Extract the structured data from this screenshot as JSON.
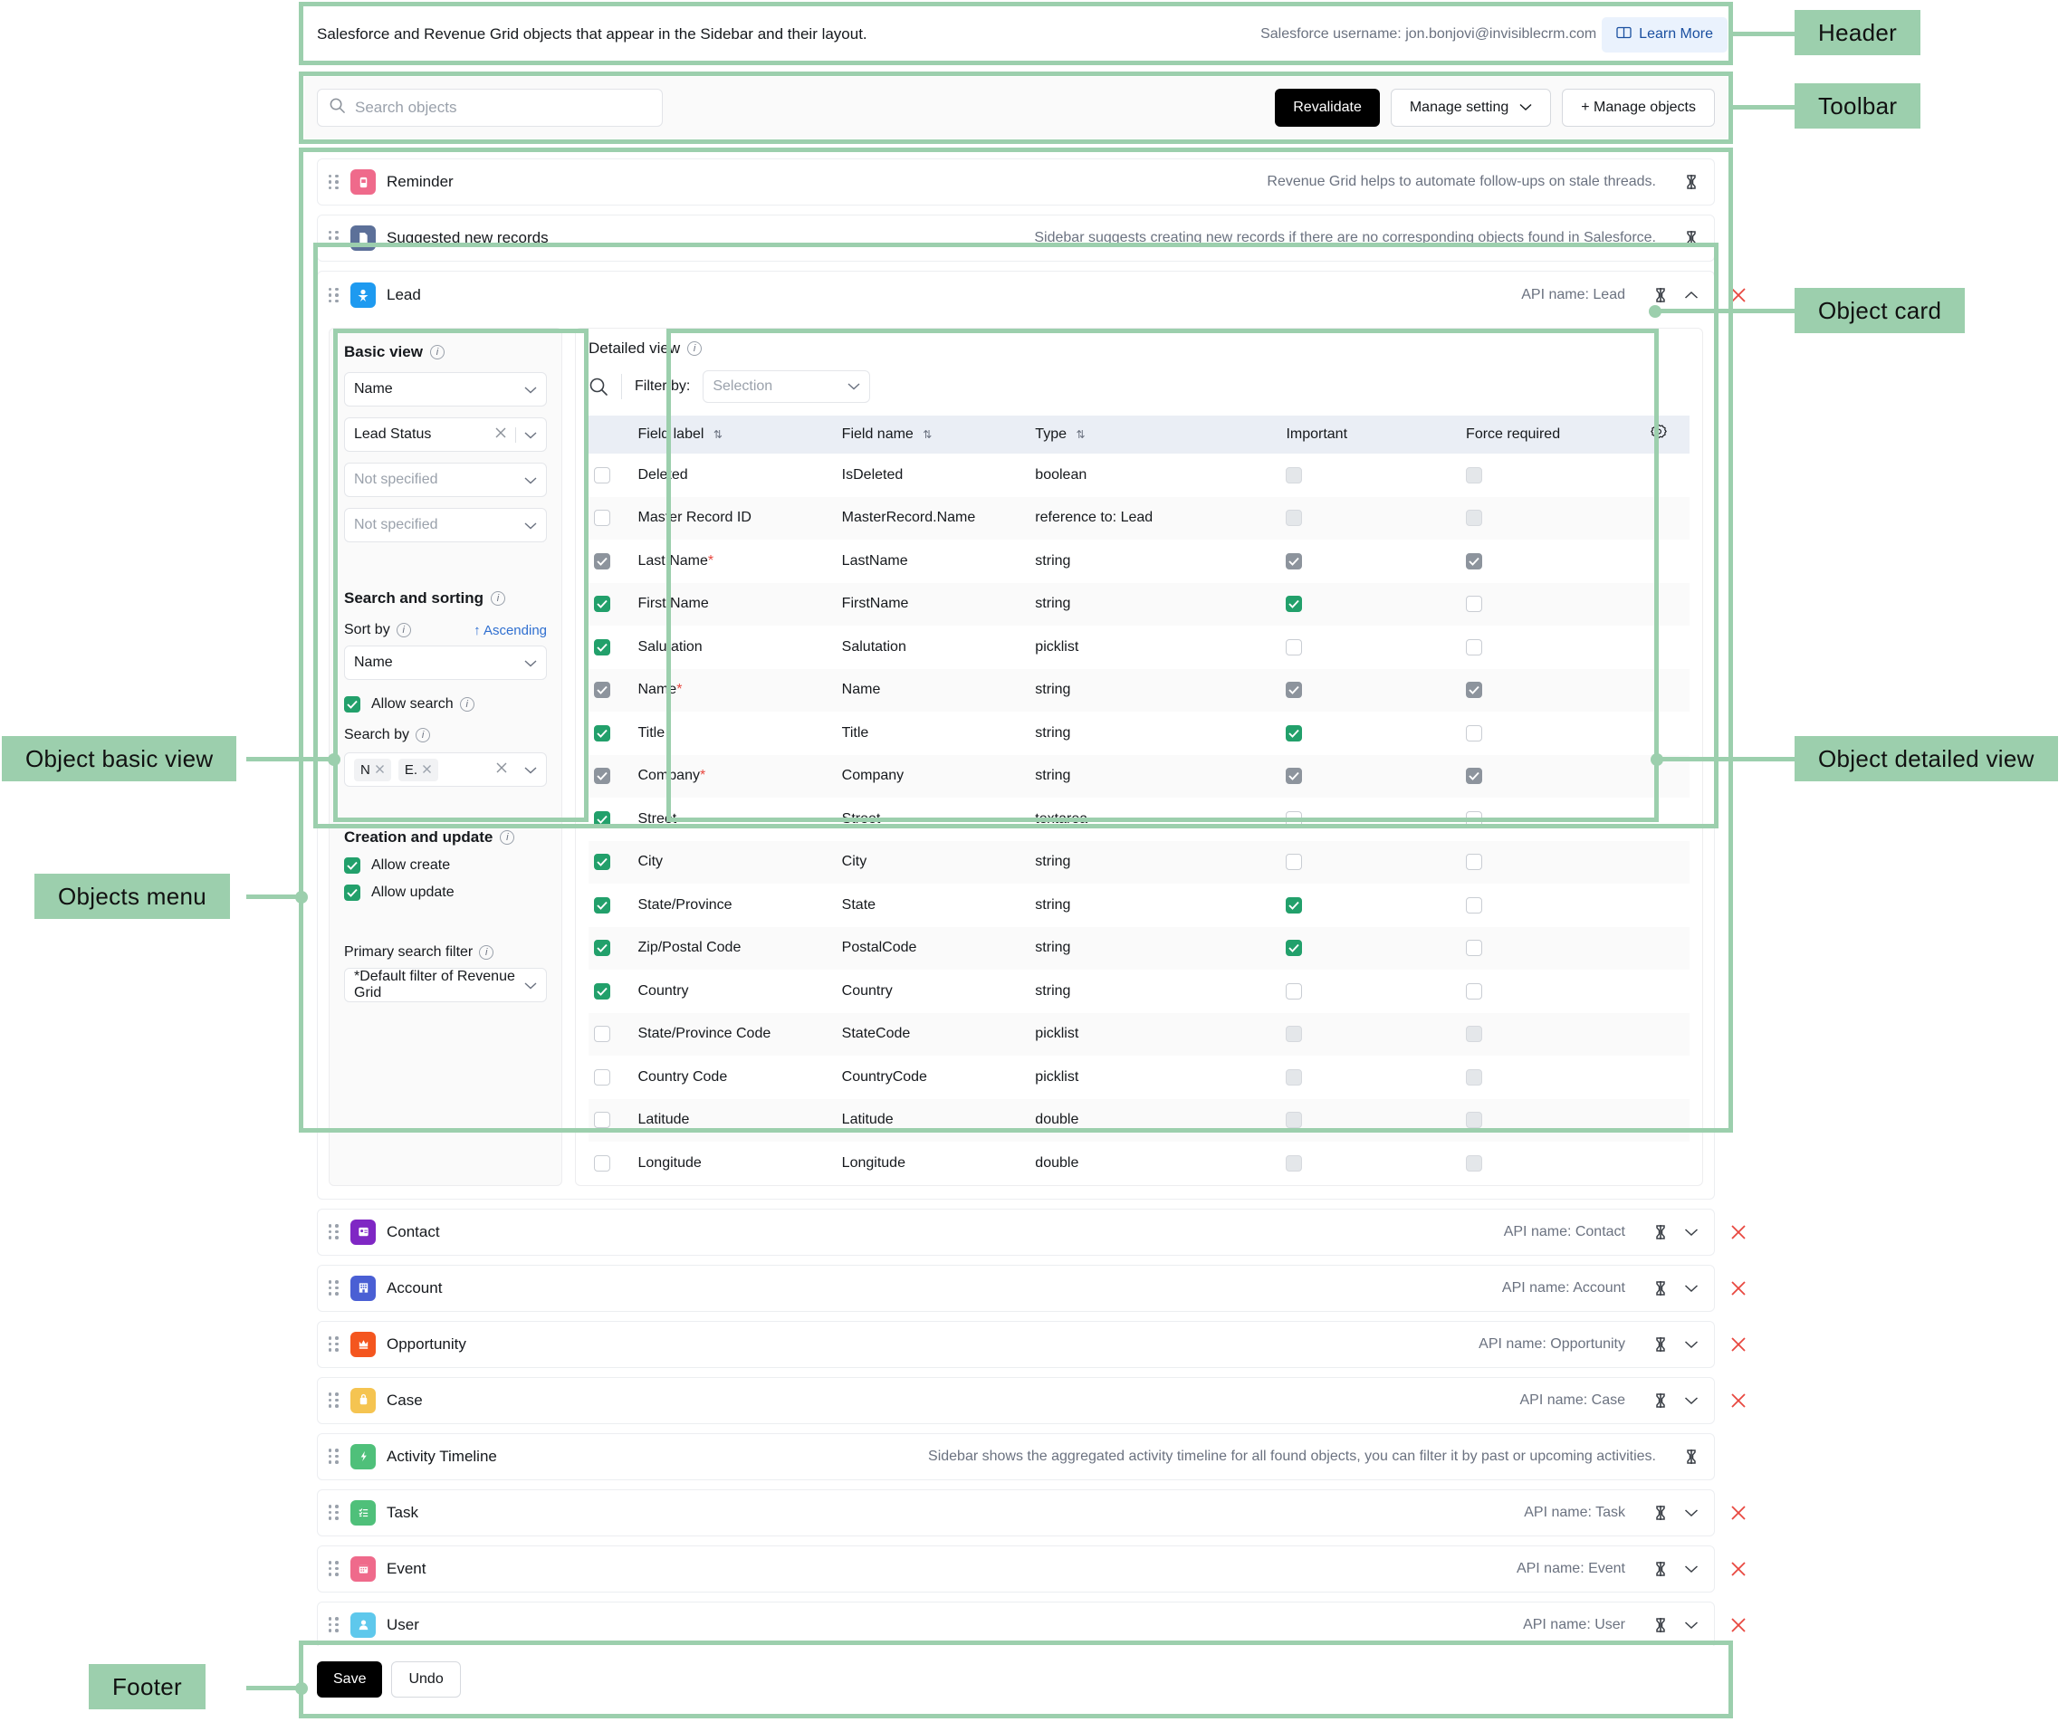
{
  "header": {
    "description": "Salesforce and Revenue Grid objects that appear in the Sidebar and their layout.",
    "username_label": "Salesforce username: jon.bonjovi@invisiblecrm.com",
    "learn_more": "Learn More"
  },
  "toolbar": {
    "search_placeholder": "Search objects",
    "revalidate": "Revalidate",
    "manage_setting": "Manage setting",
    "manage_objects": "+ Manage objects"
  },
  "objects": [
    {
      "name": "Reminder",
      "desc": "Revenue Grid helps to automate follow-ups on stale threads.",
      "color": "#ef6a8b",
      "glyph": "⏰",
      "has_chevron": false,
      "has_close": false
    },
    {
      "name": "Suggested new records",
      "desc": "Sidebar suggests creating new records if there are no corresponding objects found in Salesforce.",
      "color": "#5c7099",
      "glyph": "⬜",
      "has_chevron": false,
      "has_close": false
    }
  ],
  "lead_card": {
    "name": "Lead",
    "api_name": "API name: Lead",
    "color": "#1e9af0",
    "glyph": "★"
  },
  "basic_view": {
    "title": "Basic view",
    "fields": [
      {
        "value": "Name",
        "placeholder": false,
        "clearable": false
      },
      {
        "value": "Lead Status",
        "placeholder": false,
        "clearable": true
      },
      {
        "value": "Not specified",
        "placeholder": true,
        "clearable": false
      },
      {
        "value": "Not specified",
        "placeholder": true,
        "clearable": false
      }
    ],
    "search_sorting_title": "Search and sorting",
    "sort_by_label": "Sort by",
    "sort_direction": "↑ Ascending",
    "sort_by_value": "Name",
    "allow_search_label": "Allow search",
    "allow_search_checked": true,
    "search_by_label": "Search by",
    "search_by_tags": [
      "N",
      "E."
    ],
    "creation_update_title": "Creation and update",
    "allow_create_label": "Allow create",
    "allow_create_checked": true,
    "allow_update_label": "Allow update",
    "allow_update_checked": true,
    "primary_filter_label": "Primary search filter",
    "primary_filter_value": "*Default filter of Revenue Grid"
  },
  "detailed_view": {
    "title": "Detailed view",
    "filter_by_label": "Filter by:",
    "filter_by_value": "Selection",
    "columns": [
      "Field label",
      "Field name",
      "Type",
      "Important",
      "Force required"
    ],
    "rows": [
      {
        "label": "Deleted",
        "required": false,
        "name": "IsDeleted",
        "type": "boolean",
        "sel": false,
        "sel_dis": false,
        "imp": false,
        "imp_dis": true,
        "force": false,
        "force_dis": true
      },
      {
        "label": "Master Record ID",
        "required": false,
        "name": "MasterRecord.Name",
        "type": "reference to: Lead",
        "sel": false,
        "sel_dis": false,
        "imp": false,
        "imp_dis": true,
        "force": false,
        "force_dis": true
      },
      {
        "label": "Last Name",
        "required": true,
        "name": "LastName",
        "type": "string",
        "sel": true,
        "sel_dis": true,
        "imp": true,
        "imp_dis": true,
        "force": true,
        "force_dis": true
      },
      {
        "label": "First Name",
        "required": false,
        "name": "FirstName",
        "type": "string",
        "sel": true,
        "sel_dis": false,
        "imp": true,
        "imp_dis": false,
        "force": false,
        "force_dis": false
      },
      {
        "label": "Salutation",
        "required": false,
        "name": "Salutation",
        "type": "picklist",
        "sel": true,
        "sel_dis": false,
        "imp": false,
        "imp_dis": false,
        "force": false,
        "force_dis": false
      },
      {
        "label": "Name",
        "required": true,
        "name": "Name",
        "type": "string",
        "sel": true,
        "sel_dis": true,
        "imp": true,
        "imp_dis": true,
        "force": true,
        "force_dis": true
      },
      {
        "label": "Title",
        "required": false,
        "name": "Title",
        "type": "string",
        "sel": true,
        "sel_dis": false,
        "imp": true,
        "imp_dis": false,
        "force": false,
        "force_dis": false
      },
      {
        "label": "Company",
        "required": true,
        "name": "Company",
        "type": "string",
        "sel": true,
        "sel_dis": true,
        "imp": true,
        "imp_dis": true,
        "force": true,
        "force_dis": true
      },
      {
        "label": "Street",
        "required": false,
        "name": "Street",
        "type": "textarea",
        "sel": true,
        "sel_dis": false,
        "imp": false,
        "imp_dis": false,
        "force": false,
        "force_dis": false
      },
      {
        "label": "City",
        "required": false,
        "name": "City",
        "type": "string",
        "sel": true,
        "sel_dis": false,
        "imp": false,
        "imp_dis": false,
        "force": false,
        "force_dis": false
      },
      {
        "label": "State/Province",
        "required": false,
        "name": "State",
        "type": "string",
        "sel": true,
        "sel_dis": false,
        "imp": true,
        "imp_dis": false,
        "force": false,
        "force_dis": false
      },
      {
        "label": "Zip/Postal Code",
        "required": false,
        "name": "PostalCode",
        "type": "string",
        "sel": true,
        "sel_dis": false,
        "imp": true,
        "imp_dis": false,
        "force": false,
        "force_dis": false
      },
      {
        "label": "Country",
        "required": false,
        "name": "Country",
        "type": "string",
        "sel": true,
        "sel_dis": false,
        "imp": false,
        "imp_dis": false,
        "force": false,
        "force_dis": false
      },
      {
        "label": "State/Province Code",
        "required": false,
        "name": "StateCode",
        "type": "picklist",
        "sel": false,
        "sel_dis": false,
        "imp": false,
        "imp_dis": true,
        "force": false,
        "force_dis": true
      },
      {
        "label": "Country Code",
        "required": false,
        "name": "CountryCode",
        "type": "picklist",
        "sel": false,
        "sel_dis": false,
        "imp": false,
        "imp_dis": true,
        "force": false,
        "force_dis": true
      },
      {
        "label": "Latitude",
        "required": false,
        "name": "Latitude",
        "type": "double",
        "sel": false,
        "sel_dis": false,
        "imp": false,
        "imp_dis": true,
        "force": false,
        "force_dis": true
      },
      {
        "label": "Longitude",
        "required": false,
        "name": "Longitude",
        "type": "double",
        "sel": false,
        "sel_dis": false,
        "imp": false,
        "imp_dis": true,
        "force": false,
        "force_dis": true
      }
    ]
  },
  "objects_bottom": [
    {
      "name": "Contact",
      "api": "API name: Contact",
      "desc": "",
      "color": "#7f27c4",
      "glyph": "▤",
      "has_chevron": true,
      "has_close": true
    },
    {
      "name": "Account",
      "api": "API name: Account",
      "desc": "",
      "color": "#4a5fd4",
      "glyph": "Ἶ2",
      "has_chevron": true,
      "has_close": true
    },
    {
      "name": "Opportunity",
      "api": "API name: Opportunity",
      "desc": "",
      "color": "#f4561f",
      "glyph": "♛",
      "has_chevron": true,
      "has_close": true
    },
    {
      "name": "Case",
      "api": "API name: Case",
      "desc": "",
      "color": "#f5c451",
      "glyph": "▭",
      "has_chevron": true,
      "has_close": true
    },
    {
      "name": "Activity Timeline",
      "api": "",
      "desc": "Sidebar shows the aggregated activity timeline for all found objects, you can filter it by past or upcoming activities.",
      "color": "#4fc07a",
      "glyph": "⚡",
      "has_chevron": false,
      "has_close": false
    },
    {
      "name": "Task",
      "api": "API name: Task",
      "desc": "",
      "color": "#4fc07a",
      "glyph": "≣",
      "has_chevron": true,
      "has_close": true
    },
    {
      "name": "Event",
      "api": "API name: Event",
      "desc": "",
      "color": "#ef6a8b",
      "glyph": "☷",
      "has_chevron": true,
      "has_close": true
    },
    {
      "name": "User",
      "api": "API name: User",
      "desc": "",
      "color": "#5ec8ec",
      "glyph": "☺",
      "has_chevron": true,
      "has_close": true
    }
  ],
  "footer": {
    "save": "Save",
    "undo": "Undo"
  },
  "annotations": {
    "header": "Header",
    "toolbar": "Toolbar",
    "object_card": "Object card",
    "object_detailed_view": "Object detailed view",
    "object_basic_view": "Object basic view",
    "objects_menu": "Objects menu",
    "footer": "Footer"
  },
  "colors": {
    "annotation_green": "#9ccfad",
    "accent_green": "#22a06b",
    "danger_red": "#e8473f",
    "link_blue": "#2f6fd0"
  }
}
